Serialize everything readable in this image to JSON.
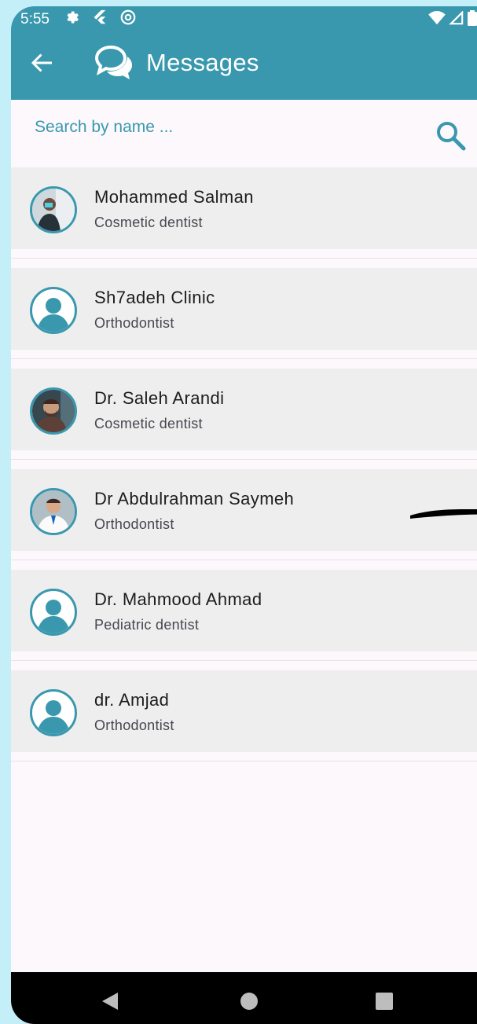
{
  "status_bar": {
    "time": "5:55",
    "icons_left": [
      "gear-icon",
      "flutter-icon",
      "at-sign-icon"
    ],
    "icons_right": [
      "wifi-icon",
      "signal-icon",
      "battery-icon"
    ]
  },
  "header": {
    "title": "Messages",
    "back_icon": "arrow-left-icon",
    "title_icon": "chat-bubbles-icon",
    "color": "#3a98ae"
  },
  "search": {
    "placeholder": "Search by name ...",
    "value": "",
    "icon": "search-icon"
  },
  "contacts": [
    {
      "name": "Mohammed Salman",
      "specialty": "Cosmetic dentist",
      "avatar": "photo"
    },
    {
      "name": "Sh7adeh Clinic",
      "specialty": "Orthodontist",
      "avatar": "default"
    },
    {
      "name": "Dr. Saleh Arandi",
      "specialty": "Cosmetic dentist",
      "avatar": "photo"
    },
    {
      "name": "Dr Abdulrahman Saymeh",
      "specialty": "Orthodontist",
      "avatar": "photo"
    },
    {
      "name": "Dr. Mahmood Ahmad",
      "specialty": "Pediatric dentist",
      "avatar": "default"
    },
    {
      "name": "dr. Amjad",
      "specialty": "Orthodontist",
      "avatar": "default"
    }
  ],
  "nav_bar": {
    "buttons": [
      "back-triangle-icon",
      "home-circle-icon",
      "recents-square-icon"
    ]
  }
}
